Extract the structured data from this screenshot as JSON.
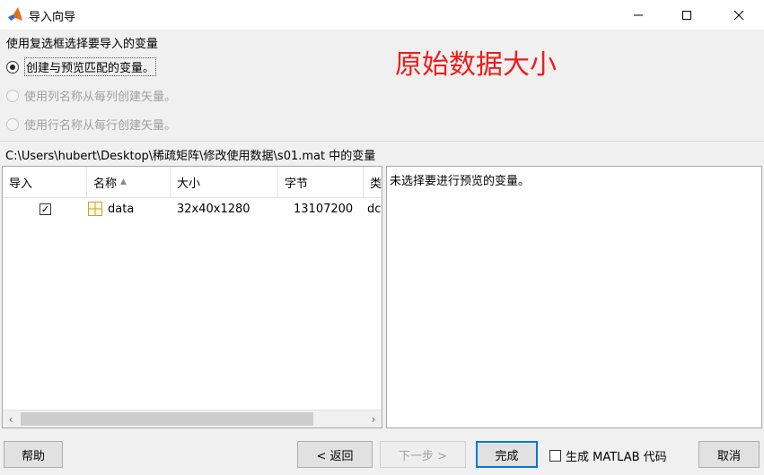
{
  "window": {
    "title": "导入向导",
    "controls": {
      "minimize": "minimize-icon",
      "maximize": "maximize-icon",
      "close": "close-icon"
    }
  },
  "options": {
    "group_label": "使用复选框选择要导入的变量",
    "radios": [
      {
        "label": "创建与预览匹配的变量。",
        "checked": true,
        "enabled": true
      },
      {
        "label": "使用列名称从每列创建矢量。",
        "checked": false,
        "enabled": false
      },
      {
        "label": "使用行名称从每行创建矢量。",
        "checked": false,
        "enabled": false
      }
    ]
  },
  "annotation": {
    "text": "原始数据大小",
    "color": "#ee1c1c"
  },
  "path_label": "C:\\Users\\hubert\\Desktop\\稀疏矩阵\\修改使用数据\\s01.mat 中的变量",
  "table": {
    "columns": [
      "导入",
      "名称",
      "大小",
      "字节",
      "类"
    ],
    "sorted_column": "名称",
    "rows": [
      {
        "import": true,
        "name": "data",
        "size": "32x40x1280",
        "bytes": "13107200",
        "class": "dc"
      }
    ]
  },
  "preview": {
    "text": "未选择要进行预览的变量。"
  },
  "buttons": {
    "help": "帮助",
    "back": "< 返回",
    "next": "下一步 >",
    "finish": "完成",
    "generate_label": "生成 MATLAB 代码",
    "cancel": "取消"
  },
  "colors": {
    "accent": "#0078d7",
    "background": "#f0f0f0"
  }
}
